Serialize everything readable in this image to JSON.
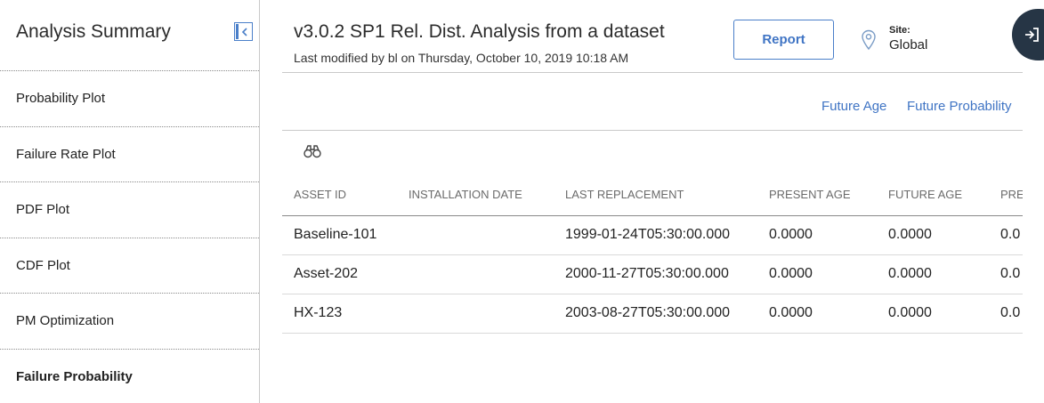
{
  "sidebar": {
    "title": "Analysis Summary",
    "collapse_icon": "collapse-left-icon",
    "items": [
      {
        "label": "Probability Plot",
        "active": false
      },
      {
        "label": "Failure Rate Plot",
        "active": false
      },
      {
        "label": "PDF Plot",
        "active": false
      },
      {
        "label": "CDF Plot",
        "active": false
      },
      {
        "label": "PM Optimization",
        "active": false
      },
      {
        "label": "Failure Probability",
        "active": true
      }
    ]
  },
  "header": {
    "title": "v3.0.2 SP1 Rel. Dist. Analysis from a dataset",
    "subtitle": "Last modified by bl on Thursday, October 10, 2019 10:18 AM",
    "report_label": "Report",
    "site_icon": "map-pin-icon",
    "site_label": "Site:",
    "site_value": "Global",
    "side_action_icon": "sign-in-icon"
  },
  "links": {
    "future_age": "Future Age",
    "future_probability": "Future Probability"
  },
  "toolbar": {
    "search_icon": "binoculars-icon"
  },
  "table": {
    "headers": [
      "ASSET ID",
      "INSTALLATION DATE",
      "LAST REPLACEMENT",
      "PRESENT AGE",
      "FUTURE AGE",
      "PRE"
    ],
    "rows": [
      [
        "Baseline-101",
        "",
        "1999-01-24T05:30:00.000",
        "0.0000",
        "0.0000",
        "0.0"
      ],
      [
        "Asset-202",
        "",
        "2000-11-27T05:30:00.000",
        "0.0000",
        "0.0000",
        "0.0"
      ],
      [
        "HX-123",
        "",
        "2003-08-27T05:30:00.000",
        "0.0000",
        "0.0000",
        "0.0"
      ]
    ]
  },
  "colors": {
    "accent": "#3f74c4",
    "dark_button": "#263545",
    "divider": "#c9c9c9"
  }
}
